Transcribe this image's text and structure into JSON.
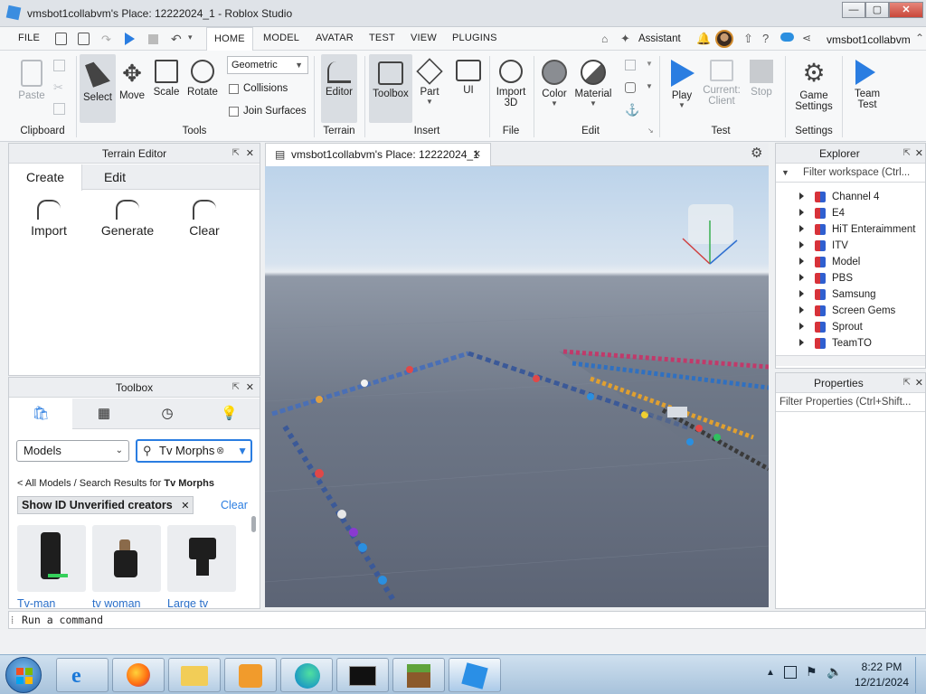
{
  "window": {
    "title": "vmsbot1collabvm's Place: 12222024_1 - Roblox Studio",
    "buttons": {
      "minimize": "—",
      "maximize": "▢",
      "close": "✕"
    }
  },
  "menu": {
    "file": "FILE",
    "tabs": [
      "HOME",
      "MODEL",
      "AVATAR",
      "TEST",
      "VIEW",
      "PLUGINS"
    ],
    "assistant": "Assistant",
    "username": "vmsbot1collabvm"
  },
  "ribbon": {
    "clipboard": {
      "paste": "Paste",
      "group": "Clipboard"
    },
    "tools": {
      "select": "Select",
      "move": "Move",
      "scale": "Scale",
      "rotate": "Rotate",
      "mode_value": "Geometric",
      "collisions": "Collisions",
      "join_surfaces": "Join Surfaces",
      "group": "Tools"
    },
    "terrain": {
      "editor": "Editor",
      "group": "Terrain"
    },
    "insert": {
      "toolbox": "Toolbox",
      "part": "Part",
      "ui": "UI",
      "group": "Insert"
    },
    "file": {
      "import_line1": "Import",
      "import_line2": "3D",
      "group": "File"
    },
    "edit": {
      "color": "Color",
      "material": "Material",
      "group": "Edit"
    },
    "test": {
      "play": "Play",
      "current_line1": "Current:",
      "current_line2": "Client",
      "stop": "Stop",
      "group": "Test"
    },
    "settings": {
      "game_line1": "Game",
      "game_line2": "Settings",
      "group": "Settings"
    },
    "team": {
      "line1": "Team",
      "line2": "Test"
    }
  },
  "terrain_editor": {
    "title": "Terrain Editor",
    "tabs": [
      "Create",
      "Edit"
    ],
    "actions": [
      "Import",
      "Generate",
      "Clear"
    ]
  },
  "toolbox": {
    "title": "Toolbox",
    "category_value": "Models",
    "search_value": "Tv Morphs",
    "breadcrumb_link": "< All Models",
    "breadcrumb_text": " / Search Results for ",
    "breadcrumb_query": "Tv Morphs",
    "filter_chip": "Show ID Unverified creators",
    "clear_label": "Clear",
    "items": [
      "Tv-man",
      "tv woman",
      "Large tv"
    ]
  },
  "document_tab": {
    "label": "vmsbot1collabvm's Place: 12222024_1"
  },
  "explorer": {
    "title": "Explorer",
    "filter_placeholder": "Filter workspace (Ctrl...",
    "items": [
      "Channel 4",
      "E4",
      "HiT Enteraimment",
      "ITV",
      "Model",
      "PBS",
      "Samsung",
      "Screen Gems",
      "Sprout",
      "TeamTO"
    ]
  },
  "properties": {
    "title": "Properties",
    "filter_placeholder": "Filter Properties (Ctrl+Shift..."
  },
  "command_bar": {
    "placeholder": "Run a command"
  },
  "taskbar": {
    "time": "8:22 PM",
    "date": "12/21/2024"
  }
}
